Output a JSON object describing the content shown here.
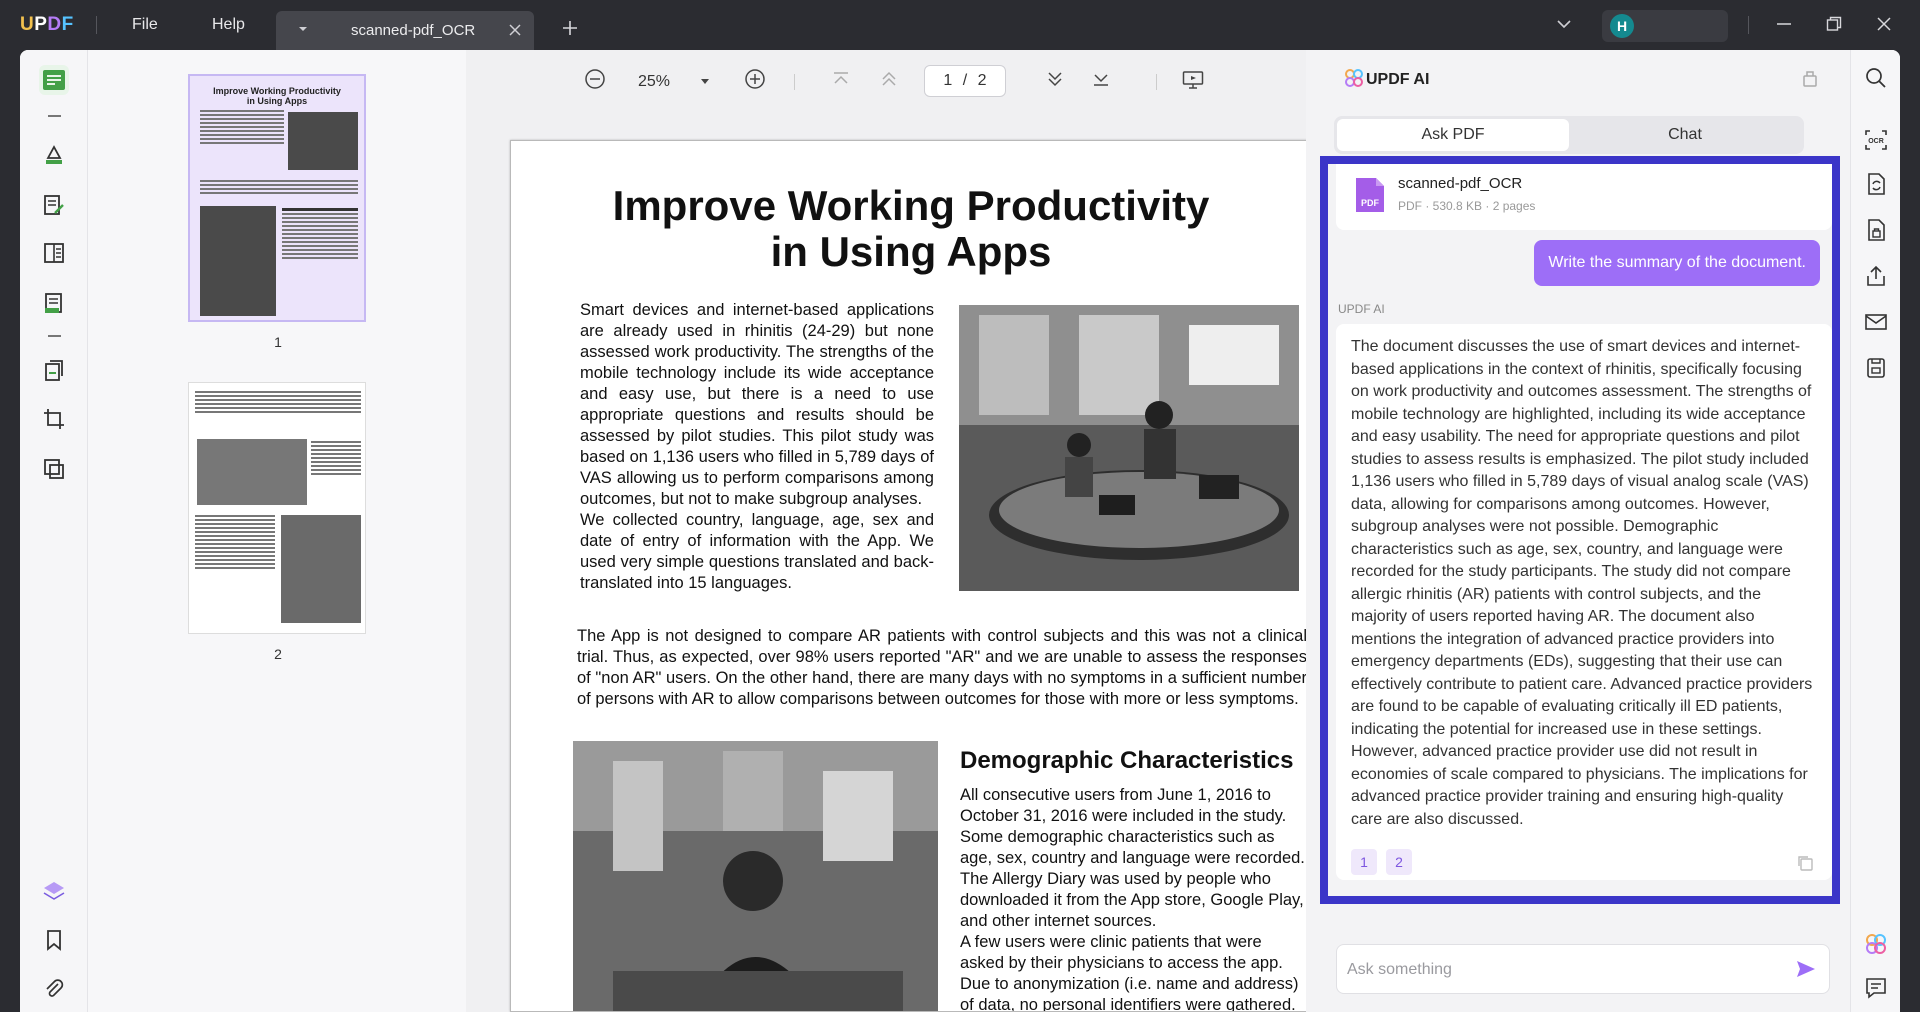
{
  "titlebar": {
    "logo": {
      "u": "U",
      "p": "P",
      "d": "D",
      "f": "F"
    },
    "menu": [
      "File",
      "Help"
    ],
    "tab_title": "scanned-pdf_OCR",
    "user_initial": "H"
  },
  "doc_toolbar": {
    "zoom": "25%",
    "page_current": "1",
    "page_total": "2",
    "page_separator": "/"
  },
  "thumbnails": {
    "page1_label": "1",
    "page2_label": "2"
  },
  "document": {
    "title_line1": "Improve Working Productivity",
    "title_line2": "in Using Apps",
    "para1": "Smart devices and internet-based applications are already used in rhinitis (24-29) but none assessed work productivity. The strengths of the mobile technology include its wide acceptance and easy use, but there is a need to use appropriate questions and results should be assessed by pilot studies. This pilot study was based on 1,136 users who filled in 5,789 days of VAS allowing us to perform comparisons among outcomes, but not to make subgroup analyses.",
    "para1b": "We collected country, language, age, sex and date of entry of information with the App. We used very simple questions translated and back-translated into 15 languages.",
    "para2": "The App is not designed to compare AR patients with control subjects and this was not a clinical trial. Thus, as expected, over 98% users reported \"AR\" and we are unable to assess the responses of \"non AR\" users. On the other hand, there are many days with no symptoms in a sufficient number of persons with AR to allow comparisons between outcomes for those with more or less symptoms.",
    "demo_title": "Demographic Characteristics",
    "para3": "All consecutive users from June 1, 2016 to October 31, 2016 were included in the study. Some demographic characteristics such as age, sex, country and language were recorded. The Allergy Diary was used by people who downloaded it from the App store, Google Play, and other internet sources.",
    "para3b": "A few users were clinic patients that were asked by their physicians to access the app. Due to anonymization (i.e. name and address) of data, no personal identifiers were gathered."
  },
  "ai_panel": {
    "title": "UPDF AI",
    "tabs": [
      "Ask PDF",
      "Chat"
    ],
    "file_name": "scanned-pdf_OCR",
    "file_meta": "PDF · 530.8 KB · 2 pages",
    "user_message": "Write the summary of the document.",
    "ai_label": "UPDF AI",
    "answer": "The document discusses the use of smart devices and internet-based applications in the context of rhinitis, specifically focusing on work productivity and outcomes assessment. The strengths of mobile technology are highlighted, including its wide acceptance and easy usability. The need for appropriate questions and pilot studies to assess results is emphasized. The pilot study included 1,136 users who filled in 5,789 days of visual analog scale (VAS) data, allowing for comparisons among outcomes. However, subgroup analyses were not possible. Demographic characteristics such as age, sex, country, and language were recorded for the study participants. The study did not compare allergic rhinitis (AR) patients with control subjects, and the majority of users reported having AR. The document also mentions the integration of advanced practice providers into emergency departments (EDs), suggesting that their use can effectively contribute to patient care. Advanced practice providers are found to be capable of evaluating critically ill ED patients, indicating the potential for increased use in these settings. However, advanced practice provider use did not result in economies of scale compared to physicians. The implications for advanced practice provider training and ensuring high-quality care are also discussed.",
    "refs": [
      "1",
      "2"
    ],
    "input_placeholder": "Ask something"
  },
  "colors": {
    "accent": "#9d6ef7",
    "highlight_border": "#3b35c8",
    "titlebar_bg": "#2b2c31",
    "avatar_bg": "#14898f"
  },
  "icons": {
    "left_rail": [
      "reader-icon",
      "highlighter-icon",
      "edit-text-icon",
      "form-icon",
      "organize-icon",
      "pages-icon",
      "crop-icon",
      "compress-icon",
      "layers-icon",
      "bookmark-icon",
      "attachment-icon"
    ],
    "right_rail": [
      "search-icon",
      "ocr-icon",
      "convert-icon",
      "protect-icon",
      "share-icon",
      "email-icon",
      "save-icon",
      "ai-icon",
      "comment-icon"
    ]
  }
}
